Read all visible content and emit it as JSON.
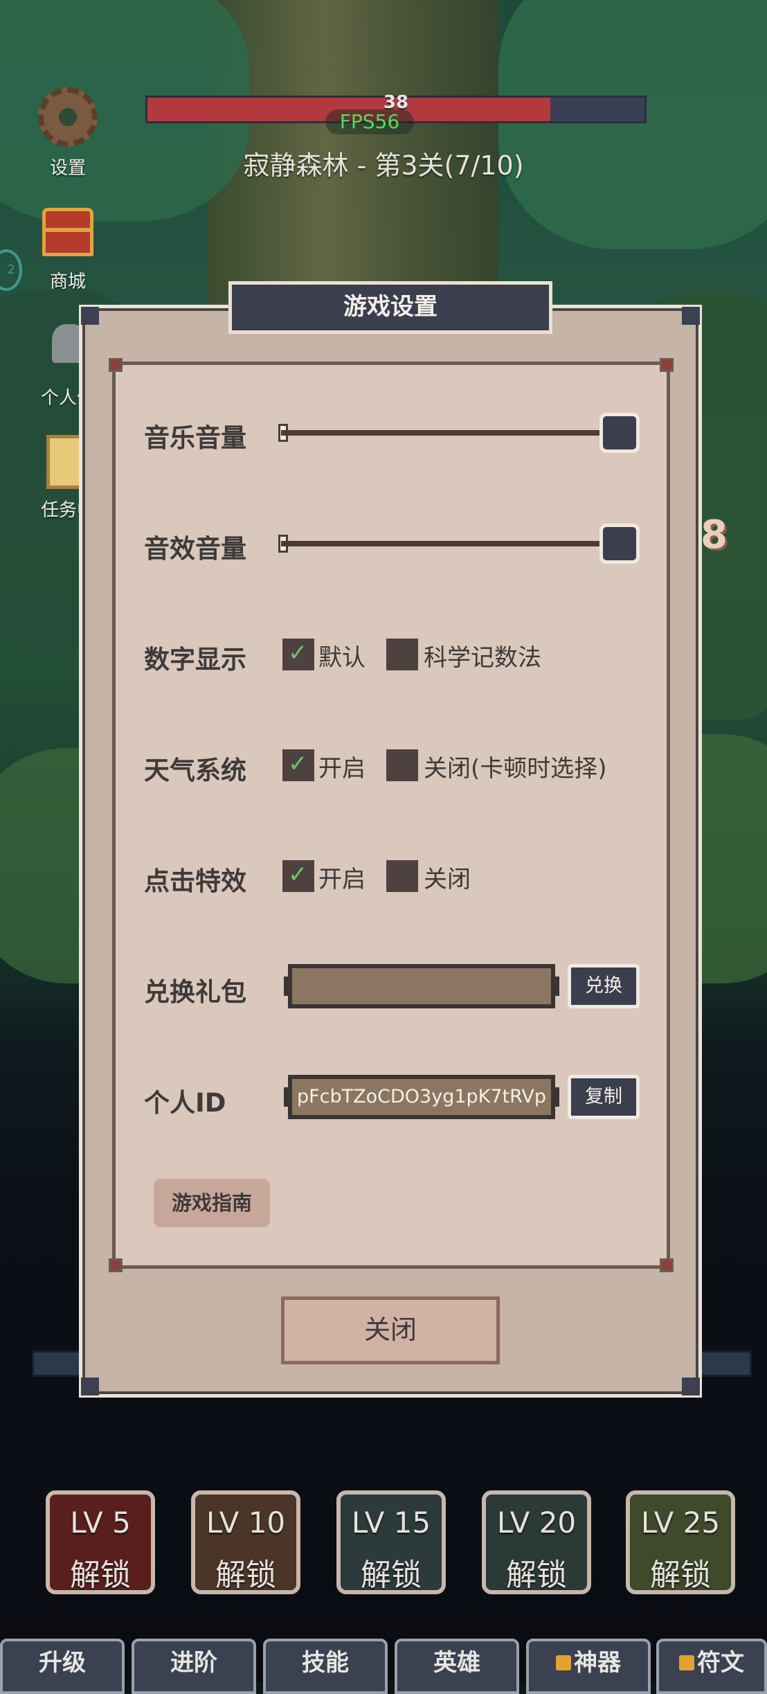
{
  "hud": {
    "hp_value": "38",
    "fps": "FPS56",
    "stage_title": "寂静森林 - 第3关(7/10)",
    "right_number": "8"
  },
  "side_menu": [
    {
      "label": "设置",
      "icon": "gear-icon"
    },
    {
      "label": "商城",
      "icon": "treasure-chest-icon"
    },
    {
      "label": "个人信",
      "icon": "helmet-icon"
    },
    {
      "label": "任务中",
      "icon": "scroll-icon"
    }
  ],
  "side_bubble": "2",
  "dialog": {
    "title": "游戏设置",
    "music_volume": {
      "label": "音乐音量",
      "value": 1.0
    },
    "sfx_volume": {
      "label": "音效音量",
      "value": 1.0
    },
    "number_display": {
      "label": "数字显示",
      "opt1": "默认",
      "opt1_checked": true,
      "opt2": "科学记数法",
      "opt2_checked": false
    },
    "weather": {
      "label": "天气系统",
      "opt1": "开启",
      "opt1_checked": true,
      "opt2": "关闭(卡顿时选择)",
      "opt2_checked": false
    },
    "click_effect": {
      "label": "点击特效",
      "opt1": "开启",
      "opt1_checked": true,
      "opt2": "关闭",
      "opt2_checked": false
    },
    "gift": {
      "label": "兑换礼包",
      "value": "",
      "button": "兑换"
    },
    "personal_id": {
      "label": "个人ID",
      "value": "pFcbTZoCDO3yg1pK7tRVp",
      "button": "复制"
    },
    "guide_button": "游戏指南",
    "close_button": "关闭"
  },
  "lock_cards": [
    {
      "lv": "LV 5",
      "text": "解锁",
      "color": "#5a1f1d"
    },
    {
      "lv": "LV 10",
      "text": "解锁",
      "color": "#4a3526"
    },
    {
      "lv": "LV 15",
      "text": "解锁",
      "color": "#2c3a3c"
    },
    {
      "lv": "LV 20",
      "text": "解锁",
      "color": "#2b3a36"
    },
    {
      "lv": "LV 25",
      "text": "解锁",
      "color": "#3e4a2a"
    }
  ],
  "tabs": [
    {
      "label": "升级",
      "locked": false
    },
    {
      "label": "进阶",
      "locked": false
    },
    {
      "label": "技能",
      "locked": false
    },
    {
      "label": "英雄",
      "locked": false
    },
    {
      "label": "神器",
      "locked": true
    },
    {
      "label": "符文",
      "locked": true
    }
  ]
}
